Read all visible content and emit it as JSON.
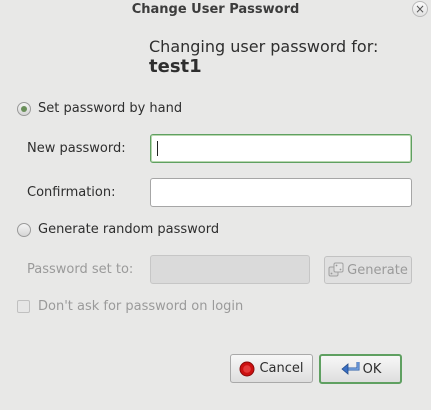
{
  "window": {
    "title": "Change User Password",
    "close_glyph": "×"
  },
  "heading": {
    "line1": "Changing user password for:",
    "username": "test1"
  },
  "options": {
    "by_hand_label": "Set password by hand",
    "by_hand_selected": true,
    "random_label": "Generate random password",
    "random_selected": false
  },
  "fields": {
    "new_password_label": "New password:",
    "new_password_value": "",
    "confirmation_label": "Confirmation:",
    "confirmation_value": "",
    "password_set_to_label": "Password set to:",
    "password_set_to_value": ""
  },
  "generate_button": {
    "label": "Generate",
    "icon": "dice-icon",
    "enabled": false
  },
  "dont_ask_checkbox": {
    "label": "Don't ask for password on login",
    "checked": false,
    "enabled": false
  },
  "buttons": {
    "cancel_label": "Cancel",
    "cancel_icon": "stop-icon",
    "ok_label": "OK",
    "ok_icon": "return-arrow-icon"
  },
  "colors": {
    "focus_accent": "#5fa061",
    "cancel_icon_red": "#cc1111",
    "ok_icon_blue": "#3a6fc4",
    "background": "#e8e8e7"
  }
}
